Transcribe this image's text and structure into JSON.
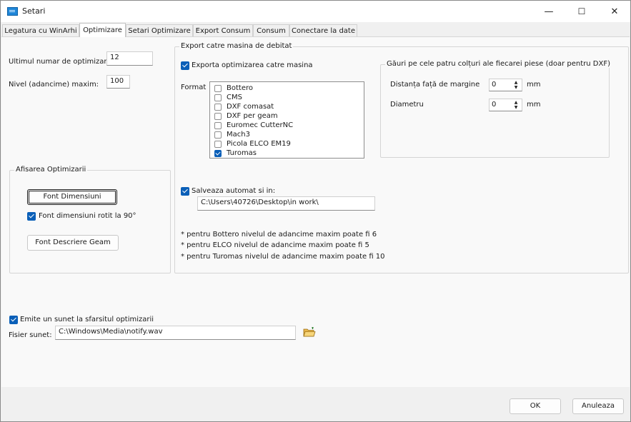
{
  "window": {
    "title": "Setari",
    "minimize": "—",
    "maximize": "☐",
    "close": "✕"
  },
  "tabs": [
    "Legatura cu WinArhi",
    "Optimizare",
    "Setari Optimizare",
    "Export Consum",
    "Consum",
    "Conectare la date"
  ],
  "left": {
    "last_opt_label": "Ultimul numar de optimizare:",
    "last_opt_value": "12",
    "max_level_label": "Nivel (adancime) maxim:",
    "max_level_value": "100",
    "display_group": "Afisarea Optimizarii",
    "font_dim_button": "Font Dimensiuni",
    "font_rot_label": "Font dimensiuni rotit la 90°",
    "font_desc_button": "Font Descriere Geam"
  },
  "export": {
    "group_title": "Export catre masina de debitat",
    "export_check": "Exporta optimizarea catre masina",
    "format_label": "Format",
    "formats": [
      {
        "name": "Bottero",
        "checked": false
      },
      {
        "name": "CMS",
        "checked": false
      },
      {
        "name": "DXF comasat",
        "checked": false
      },
      {
        "name": "DXF per geam",
        "checked": false
      },
      {
        "name": "Euromec CutterNC",
        "checked": false
      },
      {
        "name": "Mach3",
        "checked": false
      },
      {
        "name": "Picola ELCO EM19",
        "checked": false
      },
      {
        "name": "Turomas",
        "checked": true
      }
    ],
    "holes_group": "Găuri pe cele patru colțuri ale fiecarei piese (doar pentru DXF)",
    "margin_label": "Distanța față de margine",
    "margin_value": "0",
    "margin_unit": "mm",
    "diameter_label": "Diametru",
    "diameter_value": "0",
    "diameter_unit": "mm",
    "autosave_check": "Salveaza automat si in:",
    "autosave_path": "C:\\Users\\40726\\Desktop\\in work\\",
    "notes": [
      "* pentru Bottero nivelul de adancime maxim poate fi 6",
      "* pentru ELCO nivelul de adancime maxim poate fi 5",
      "* pentru Turomas nivelul de adancime maxim poate fi 10"
    ]
  },
  "sound": {
    "check_label": "Emite un sunet la sfarsitul optimizarii",
    "file_label": "Fisier sunet:",
    "file_value": "C:\\Windows\\Media\\notify.wav"
  },
  "footer": {
    "ok": "OK",
    "cancel": "Anuleaza"
  },
  "icons": {
    "app": "app-icon",
    "folder": "folder-open-icon"
  },
  "colors": {
    "accent": "#0a5fb8"
  }
}
